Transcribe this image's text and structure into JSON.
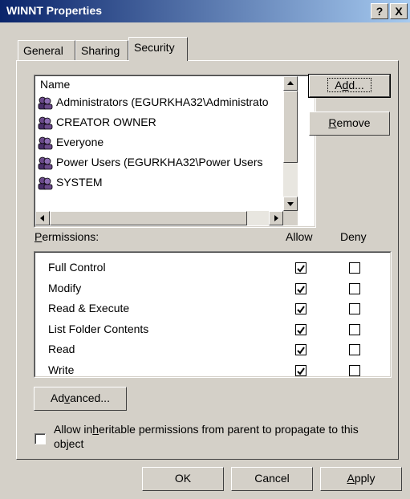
{
  "window": {
    "title": "WINNT Properties",
    "help_glyph": "?",
    "close_glyph": "X"
  },
  "tabs": [
    {
      "label": "General",
      "active": false
    },
    {
      "label": "Sharing",
      "active": false
    },
    {
      "label": "Security",
      "active": true
    }
  ],
  "names_list": {
    "header": "Name",
    "items": [
      "Administrators (EGURKHA32\\Administrato",
      "CREATOR OWNER",
      "Everyone",
      "Power Users (EGURKHA32\\Power Users",
      "SYSTEM"
    ]
  },
  "buttons": {
    "add_prefix": "A",
    "add_mnemonic": "d",
    "add_suffix": "d...",
    "remove_mnemonic": "R",
    "remove_suffix": "emove",
    "advanced_prefix": "Ad",
    "advanced_mnemonic": "v",
    "advanced_suffix": "anced...",
    "ok": "OK",
    "cancel": "Cancel",
    "apply_mnemonic": "A",
    "apply_suffix": "pply"
  },
  "permissions": {
    "label_mnemonic": "P",
    "label_suffix": "ermissions:",
    "allow_header": "Allow",
    "deny_header": "Deny",
    "rows": [
      {
        "name": "Full Control",
        "allow": true,
        "deny": false
      },
      {
        "name": "Modify",
        "allow": true,
        "deny": false
      },
      {
        "name": "Read & Execute",
        "allow": true,
        "deny": false
      },
      {
        "name": "List Folder Contents",
        "allow": true,
        "deny": false
      },
      {
        "name": "Read",
        "allow": true,
        "deny": false
      },
      {
        "name": "Write",
        "allow": true,
        "deny": false
      }
    ]
  },
  "inherit": {
    "line1_prefix": "Allow in",
    "line1_mnemonic": "h",
    "line1_suffix": "eritable permissions from parent to propagate to this",
    "line2": "object",
    "checked": false
  },
  "colors": {
    "titlebar_start": "#0a246a",
    "titlebar_end": "#a6caf0",
    "face": "#d4d0c8"
  }
}
